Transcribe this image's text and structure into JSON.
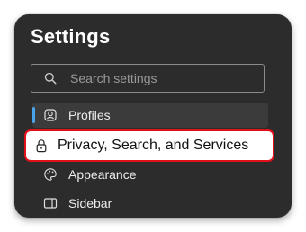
{
  "settings": {
    "title": "Settings",
    "search": {
      "placeholder": "Search settings",
      "value": ""
    },
    "nav": {
      "profiles": {
        "label": "Profiles",
        "icon": "profile-icon"
      },
      "privacy": {
        "label": "Privacy, Search, and Services",
        "icon": "lock-icon"
      },
      "appearance": {
        "label": "Appearance",
        "icon": "palette-icon"
      },
      "sidebar": {
        "label": "Sidebar",
        "icon": "sidebar-icon"
      }
    },
    "colors": {
      "panel": "#2c2c2c",
      "accent": "#4aa3e8",
      "highlight_border": "#e0101a"
    }
  }
}
